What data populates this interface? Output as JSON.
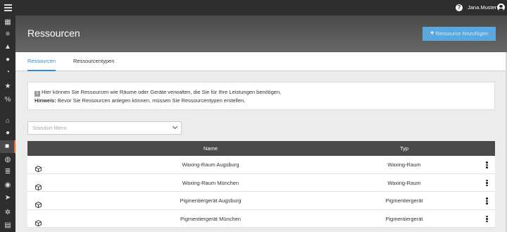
{
  "topbar": {
    "username": "Jana.Muster"
  },
  "sidebar": {
    "items": [
      {
        "icon": "calendar-icon",
        "glyph": "▦"
      },
      {
        "icon": "list-icon",
        "glyph": "≡"
      },
      {
        "icon": "graduation-cap-icon",
        "glyph": "▲"
      },
      {
        "icon": "users-icon",
        "glyph": "●"
      },
      {
        "icon": "pie-chart-icon",
        "glyph": "◔"
      },
      {
        "icon": "star-icon",
        "glyph": "★"
      },
      {
        "icon": "percent-icon",
        "glyph": "%"
      },
      {
        "icon": "home-icon",
        "glyph": "⌂"
      },
      {
        "icon": "user-icon",
        "glyph": "●"
      },
      {
        "icon": "cube-icon",
        "glyph": "■",
        "active": true
      },
      {
        "icon": "globe-icon",
        "glyph": "◍"
      },
      {
        "icon": "database-icon",
        "glyph": "≣"
      },
      {
        "icon": "world-icon",
        "glyph": "◉"
      },
      {
        "icon": "send-icon",
        "glyph": "➤"
      },
      {
        "icon": "gear-icon",
        "glyph": "✲"
      },
      {
        "icon": "document-icon",
        "glyph": "▤"
      }
    ]
  },
  "header": {
    "title": "Ressourcen",
    "add_button": "Ressource hinzufügen"
  },
  "tabs": [
    "Ressourcen",
    "Ressourcentypen"
  ],
  "info": {
    "line1": "Hier können Sie Ressourcen wie Räume oder Geräte verwalten, die Sie für Ihre Leistungen benötigen.",
    "hint_label": "Hinweis:",
    "hint_text": " Bevor Sie Ressourcen anlegen können, müssen Sie Ressourcentypen erstellen."
  },
  "filter": {
    "placeholder": "Standort filtern"
  },
  "table": {
    "headers": {
      "name": "Name",
      "type": "Typ"
    },
    "rows": [
      {
        "name": "Waxing-Raum Augsburg",
        "type": "Waxing-Raum"
      },
      {
        "name": "Waxing-Raum München",
        "type": "Waxing-Raum"
      },
      {
        "name": "Pigmentiergerät Augsburg",
        "type": "Pigmentiergerät"
      },
      {
        "name": "Pigmentiergerät München",
        "type": "Pigmentiergerät"
      }
    ]
  }
}
